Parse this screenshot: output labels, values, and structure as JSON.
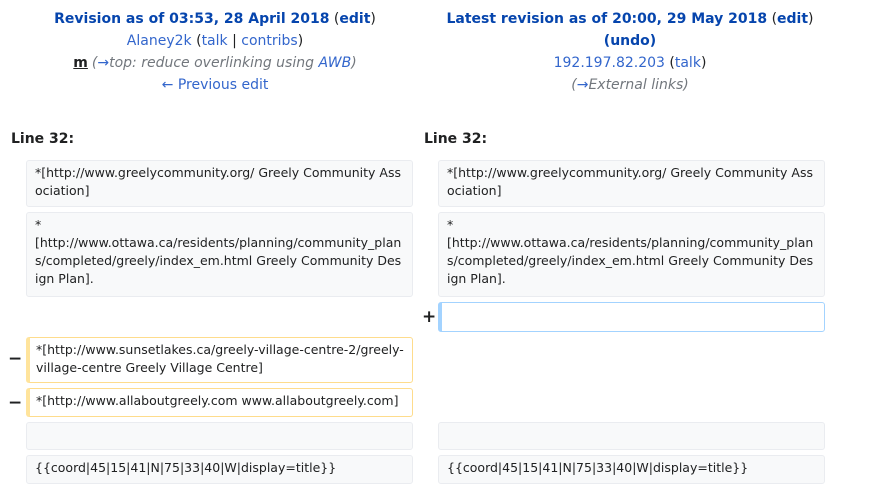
{
  "left_header": {
    "title_prefix": "Revision as of 03:53, 28 April 2018",
    "edit_label": "edit",
    "user": "Alaney2k",
    "talk": "talk",
    "contribs": "contribs",
    "minor": "m",
    "summary_arrow": "→",
    "summary_section": "top:",
    "summary_text": " reduce overlinking using ",
    "summary_tool": "AWB",
    "prev_edit": "← Previous edit"
  },
  "right_header": {
    "title_prefix": "Latest revision as of 20:00, 29 May 2018",
    "edit_label": "edit",
    "undo_label": "undo",
    "user": "192.197.82.203",
    "talk": "talk",
    "summary_arrow": "→",
    "summary_section": "External links"
  },
  "line_number_left": "Line 32:",
  "line_number_right": "Line 32:",
  "diff_rows": [
    {
      "left": "*[http://www.greelycommunity.org/ Greely Community Association]",
      "right": "*[http://www.greelycommunity.org/ Greely Community Association]"
    },
    {
      "left": "*\n[http://www.ottawa.ca/residents/planning/community_plans/completed/greely/index_em.html Greely Community Design Plan].",
      "right": "*\n[http://www.ottawa.ca/residents/planning/community_plans/completed/greely/index_em.html Greely Community Design Plan]."
    },
    {
      "added": ""
    },
    {
      "deleted": "*[http://www.sunsetlakes.ca/greely-village-centre-2/greely-village-centre Greely Village Centre]"
    },
    {
      "deleted": "*[http://www.allaboutgreely.com www.allaboutgreely.com]"
    },
    {
      "left": "",
      "right": ""
    },
    {
      "left": "{{coord|45|15|41|N|75|33|40|W|display=title}}",
      "right": "{{coord|45|15|41|N|75|33|40|W|display=title}}"
    }
  ],
  "markers": {
    "minus": "−",
    "plus": "+"
  }
}
